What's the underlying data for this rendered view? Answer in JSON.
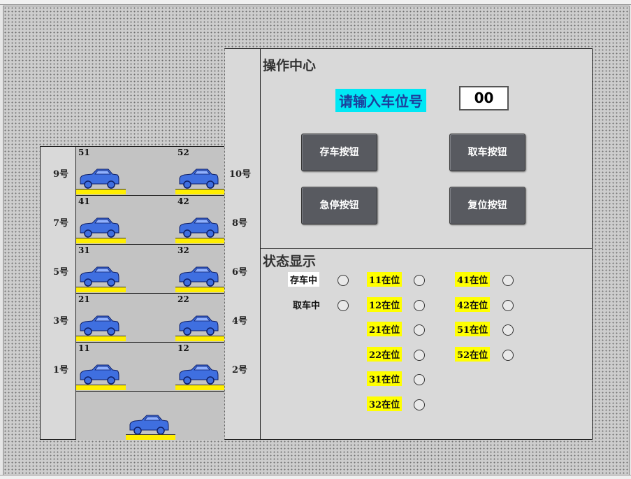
{
  "garage": {
    "floors_left": [
      "9号",
      "7号",
      "5号",
      "3号",
      "1号"
    ],
    "floors_right": [
      "10号",
      "8号",
      "6号",
      "4号",
      "2号"
    ],
    "slots_left": [
      "51",
      "41",
      "31",
      "21",
      "11"
    ],
    "slots_right": [
      "52",
      "42",
      "32",
      "22",
      "12"
    ]
  },
  "control": {
    "title": "操作中心",
    "prompt": "请输入车位号",
    "input_value": "00",
    "buttons": {
      "park": "存车按钮",
      "retrieve": "取车按钮",
      "estop": "急停按钮",
      "reset": "复位按钮"
    }
  },
  "status": {
    "title": "状态显示",
    "parking": "存车中",
    "retrieving": "取车中",
    "col1": [
      "11在位",
      "12在位",
      "21在位",
      "22在位",
      "31在位",
      "32在位"
    ],
    "col2": [
      "41在位",
      "42在位",
      "51在位",
      "52在位"
    ]
  },
  "colors": {
    "car": "#3f6fe0",
    "pallet": "#ffee00",
    "prompt_bg": "#00e8f5",
    "indicator_label_bg": "#ffff00"
  },
  "icons": {
    "car": "car-icon",
    "indicator": "indicator-lamp-icon"
  }
}
